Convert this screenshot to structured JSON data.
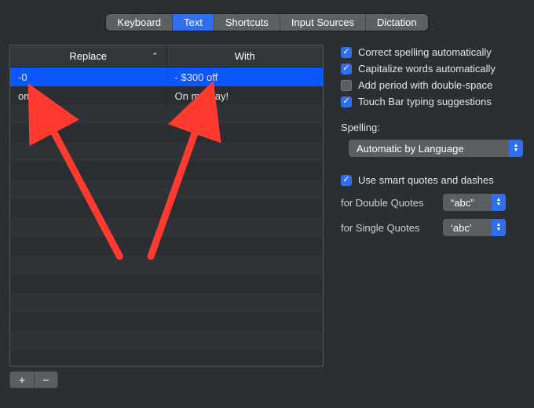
{
  "tabs": [
    "Keyboard",
    "Text",
    "Shortcuts",
    "Input Sources",
    "Dictation"
  ],
  "active_tab_index": 1,
  "table": {
    "columns": [
      "Replace",
      "With"
    ],
    "sort_column_index": 0,
    "sort_indicator": "⌃",
    "rows": [
      {
        "replace": "-0",
        "with": "- $300 off",
        "selected": true
      },
      {
        "replace": "omw",
        "with": "On my way!",
        "selected": false
      }
    ],
    "empty_row_count": 14
  },
  "footer": {
    "add": "+",
    "remove": "−"
  },
  "options": {
    "correct_spelling": {
      "checked": true,
      "label": "Correct spelling automatically"
    },
    "capitalize_words": {
      "checked": true,
      "label": "Capitalize words automatically"
    },
    "add_period": {
      "checked": false,
      "label": "Add period with double-space"
    },
    "touch_bar": {
      "checked": true,
      "label": "Touch Bar typing suggestions"
    }
  },
  "spelling": {
    "label": "Spelling:",
    "value": "Automatic by Language"
  },
  "smart_quotes": {
    "enable": {
      "checked": true,
      "label": "Use smart quotes and dashes"
    },
    "double_label": "for Double Quotes",
    "double_value": "“abc”",
    "single_label": "for Single Quotes",
    "single_value": "‘abc’"
  },
  "annotations": {
    "arrow_color": "#ff3b30"
  }
}
